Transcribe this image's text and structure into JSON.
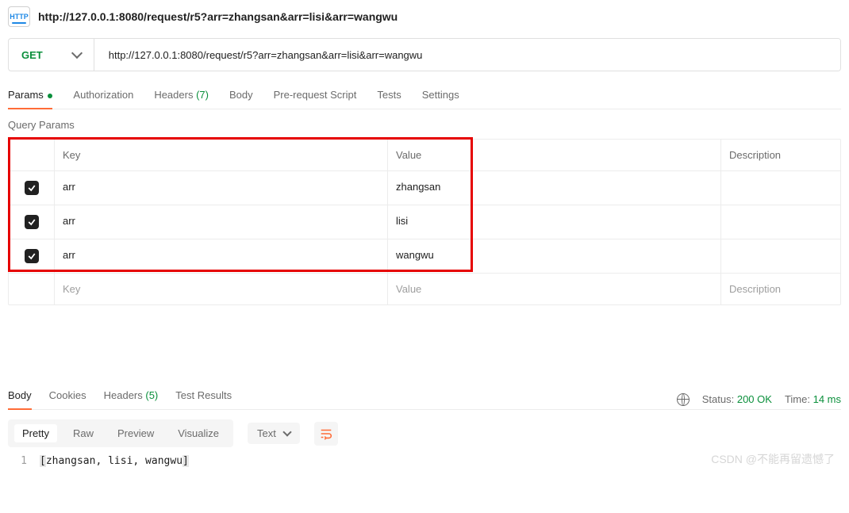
{
  "address_bar": "http://127.0.0.1:8080/request/r5?arr=zhangsan&arr=lisi&arr=wangwu",
  "request": {
    "method": "GET",
    "url": "http://127.0.0.1:8080/request/r5?arr=zhangsan&arr=lisi&arr=wangwu"
  },
  "tabs": {
    "params": "Params",
    "auth": "Authorization",
    "headers": "Headers",
    "headers_count": "(7)",
    "body": "Body",
    "prerequest": "Pre-request Script",
    "tests": "Tests",
    "settings": "Settings"
  },
  "query_params_title": "Query Params",
  "table": {
    "headers": {
      "key": "Key",
      "value": "Value",
      "desc": "Description"
    },
    "rows": [
      {
        "key": "arr",
        "value": "zhangsan",
        "checked": true
      },
      {
        "key": "arr",
        "value": "lisi",
        "checked": true
      },
      {
        "key": "arr",
        "value": "wangwu",
        "checked": true
      }
    ],
    "placeholders": {
      "key": "Key",
      "value": "Value",
      "desc": "Description"
    }
  },
  "response": {
    "tabs": {
      "body": "Body",
      "cookies": "Cookies",
      "headers": "Headers",
      "headers_count": "(5)",
      "tests": "Test Results"
    },
    "status_label": "Status:",
    "status_value": "200 OK",
    "time_label": "Time:",
    "time_value": "14 ms",
    "views": {
      "pretty": "Pretty",
      "raw": "Raw",
      "preview": "Preview",
      "visualize": "Visualize"
    },
    "mode": "Text",
    "line_number": "1",
    "body_text": "[zhangsan, lisi, wangwu]"
  },
  "watermark": "CSDN @不能再留遗憾了"
}
